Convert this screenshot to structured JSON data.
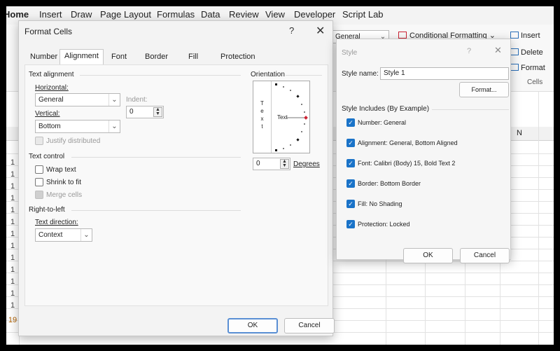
{
  "ribbon": {
    "tabs": [
      "Home",
      "Insert",
      "Draw",
      "Page Layout",
      "Formulas",
      "Data",
      "Review",
      "View",
      "Developer",
      "Script Lab"
    ],
    "number_format": "General",
    "conditional_formatting": "Conditional Formatting",
    "insert": "Insert",
    "delete": "Delete",
    "format": "Format",
    "cells_group": "Cells",
    "col_n": "N",
    "row_numbers": [
      "1",
      "1",
      "1",
      "1",
      "1",
      "1",
      "1",
      "1",
      "1",
      "1",
      "1",
      "1",
      "1",
      "19"
    ]
  },
  "format_cells": {
    "title": "Format Cells",
    "help": "?",
    "close": "✕",
    "tabs": [
      "Number",
      "Alignment",
      "Font",
      "Border",
      "Fill",
      "Protection"
    ],
    "active_tab": "Alignment",
    "text_alignment_heading": "Text alignment",
    "horizontal_label": "Horizontal:",
    "horizontal_value": "General",
    "indent_label": "Indent:",
    "indent_value": "0",
    "vertical_label": "Vertical:",
    "vertical_value": "Bottom",
    "justify_distributed": "Justify distributed",
    "text_control_heading": "Text control",
    "wrap_text": "Wrap text",
    "shrink_to_fit": "Shrink to fit",
    "merge_cells": "Merge cells",
    "rtl_heading": "Right-to-left",
    "text_direction_label": "Text direction:",
    "text_direction_value": "Context",
    "orientation_heading": "Orientation",
    "orientation_vertical_letters": [
      "T",
      "e",
      "x",
      "t"
    ],
    "orientation_text": "Text",
    "degrees_value": "0",
    "degrees_label": "Degrees",
    "ok": "OK",
    "cancel": "Cancel"
  },
  "style_dialog": {
    "title": "Style",
    "help": "?",
    "close": "✕",
    "style_name_label": "Style name:",
    "style_name_value": "Style 1",
    "format_button": "Format...",
    "includes_heading": "Style Includes (By Example)",
    "items": [
      "Number: General",
      "Alignment: General, Bottom Aligned",
      "Font: Calibri (Body) 15, Bold Text 2",
      "Border: Bottom Border",
      "Fill: No Shading",
      "Protection: Locked"
    ],
    "ok": "OK",
    "cancel": "Cancel"
  },
  "colors": {
    "accent": "#1a73c8",
    "dialog_bg": "#f3f3f3"
  }
}
